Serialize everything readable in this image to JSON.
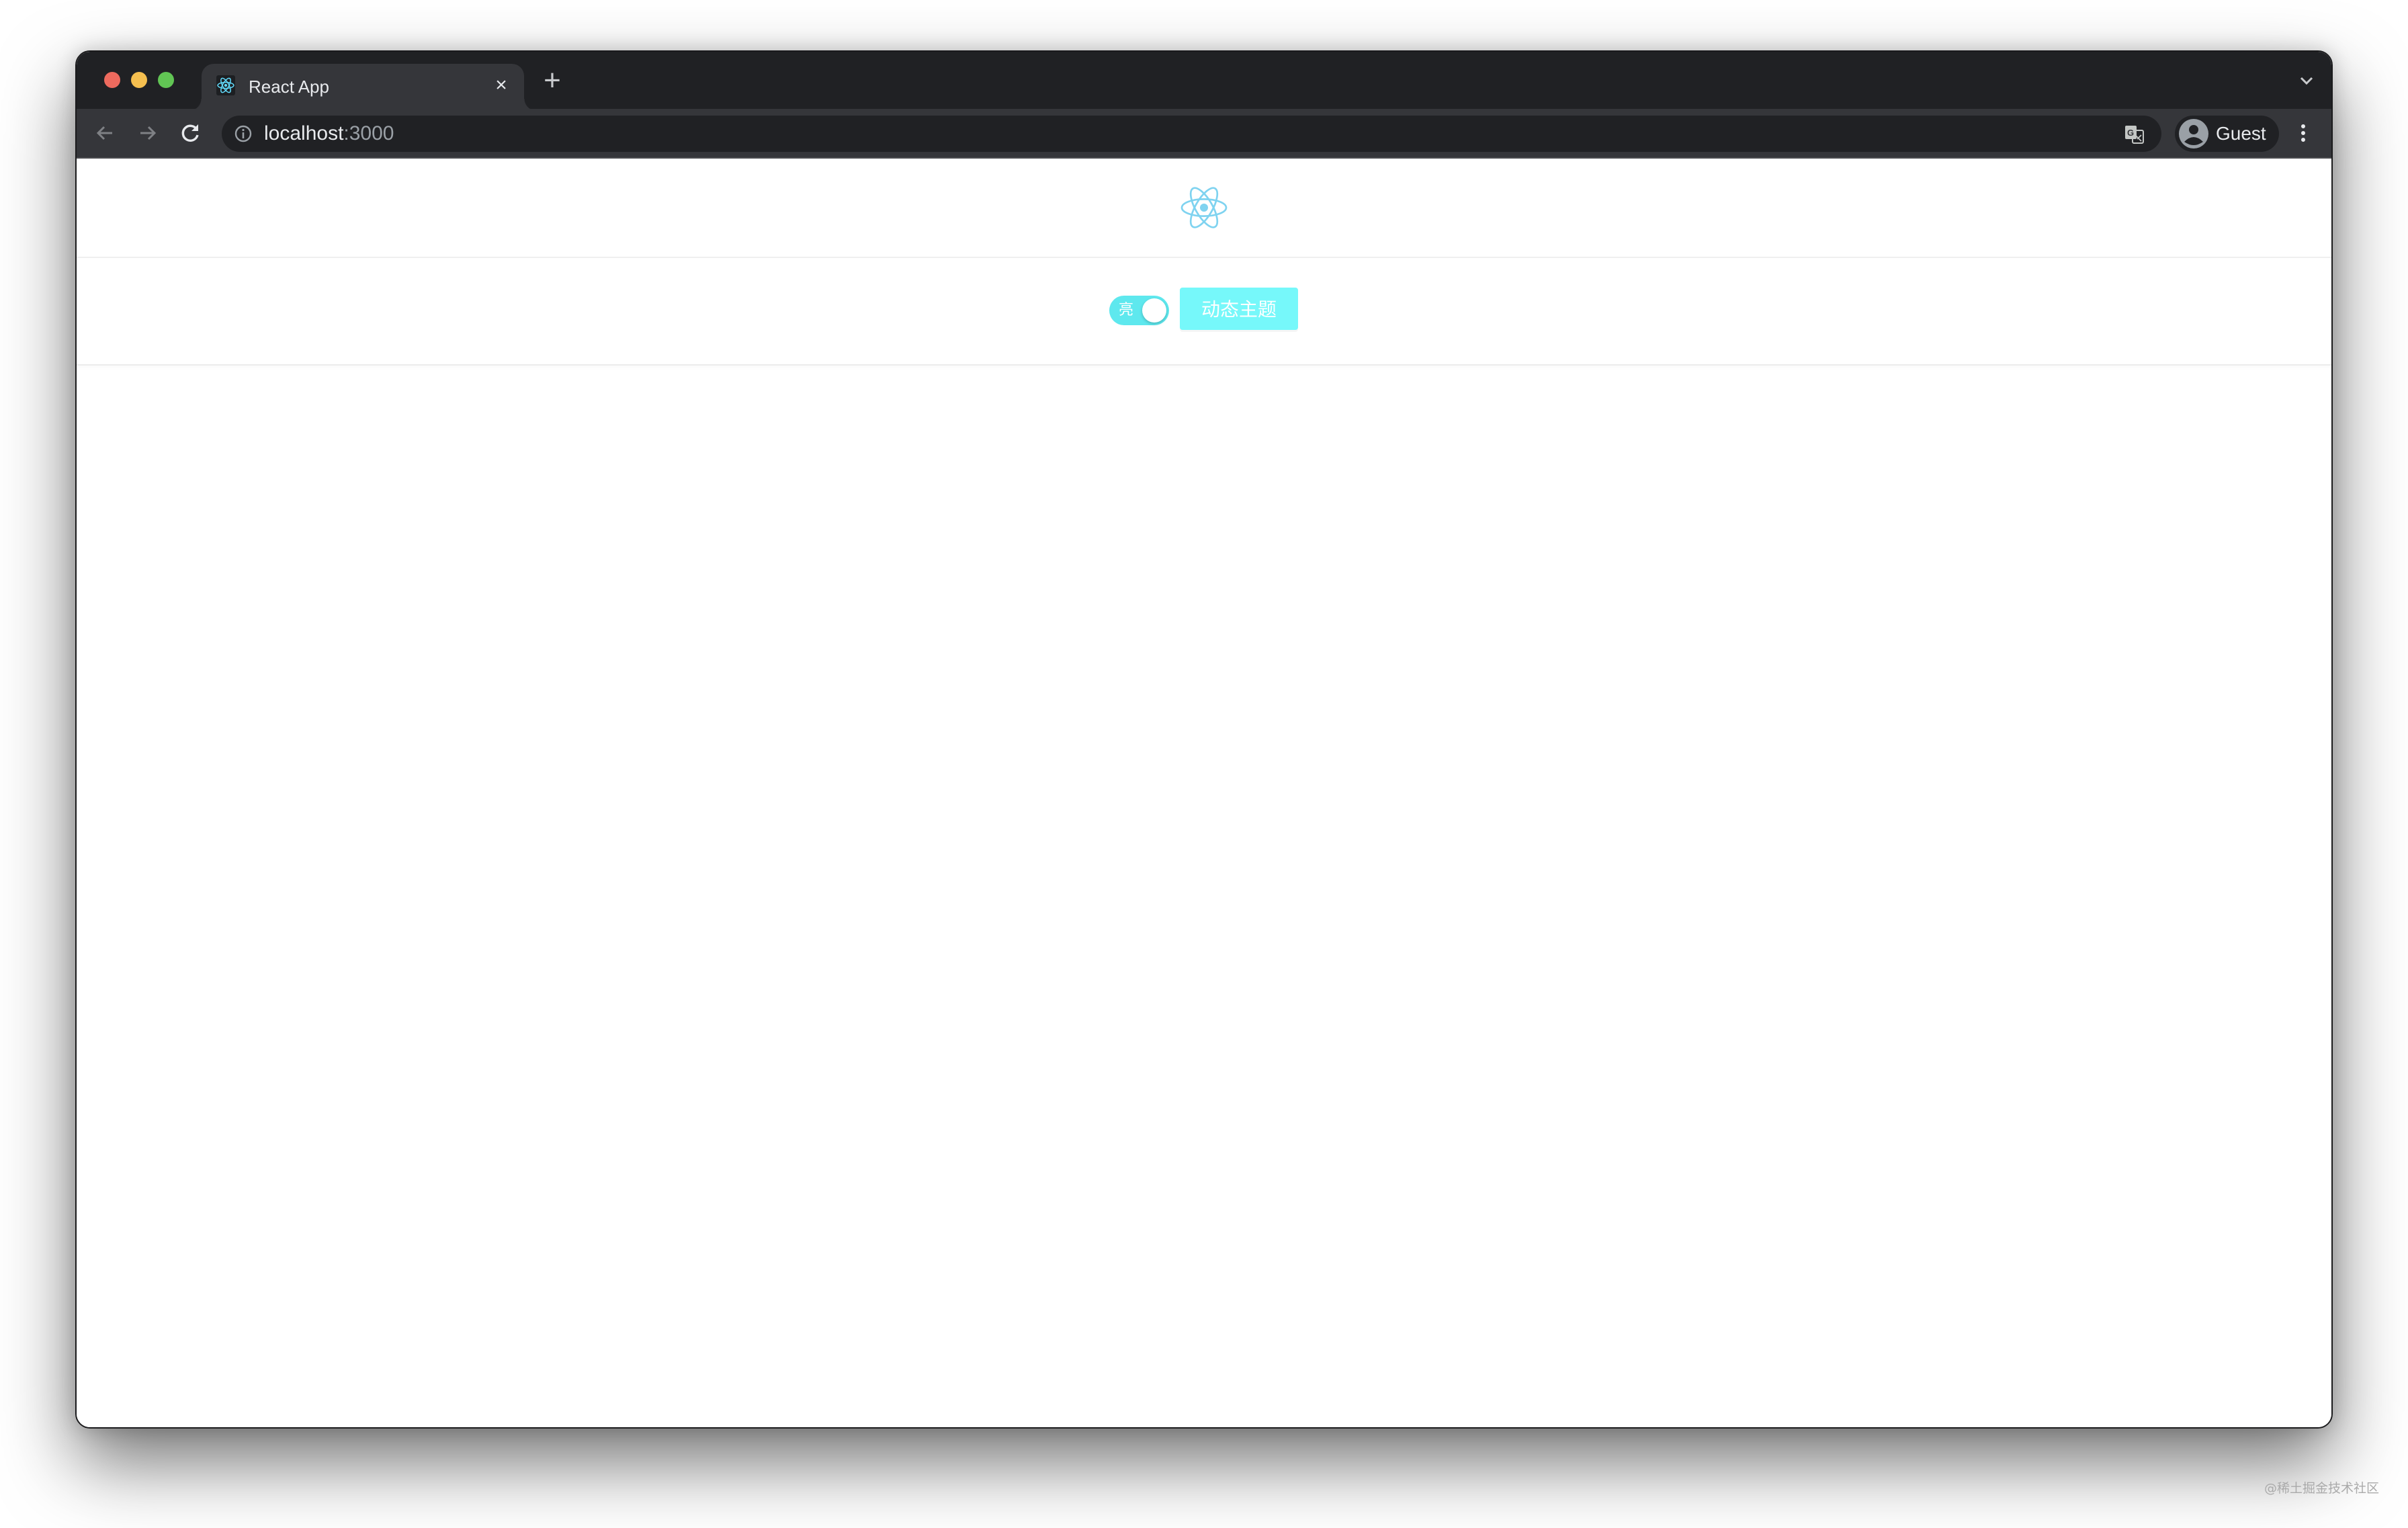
{
  "browser": {
    "tab": {
      "title": "React App",
      "favicon": "react-logo-icon",
      "close_label": "×"
    },
    "new_tab_label": "+",
    "tab_search_icon": "chevron-down-icon",
    "nav": {
      "back_icon": "arrow-left-icon",
      "forward_icon": "arrow-right-icon",
      "reload_icon": "reload-icon"
    },
    "omnibox": {
      "host": "localhost",
      "port": ":3000",
      "info_icon": "info-icon",
      "translate_icon": "translate-icon"
    },
    "profile": {
      "name": "Guest",
      "avatar_icon": "person-avatar-icon"
    },
    "menu_icon": "kebab-menu-icon"
  },
  "app": {
    "logo_icon": "react-logo-icon",
    "theme_toggle": {
      "label": "亮",
      "checked": true,
      "color": "#5ee8ee"
    },
    "theme_button": {
      "label": "动态主题",
      "color": "#76f8fa"
    }
  },
  "watermark": "@稀土掘金技术社区",
  "colors": {
    "tabstrip": "#202124",
    "toolbar": "#35363a",
    "react_blue": "#61dafb"
  }
}
